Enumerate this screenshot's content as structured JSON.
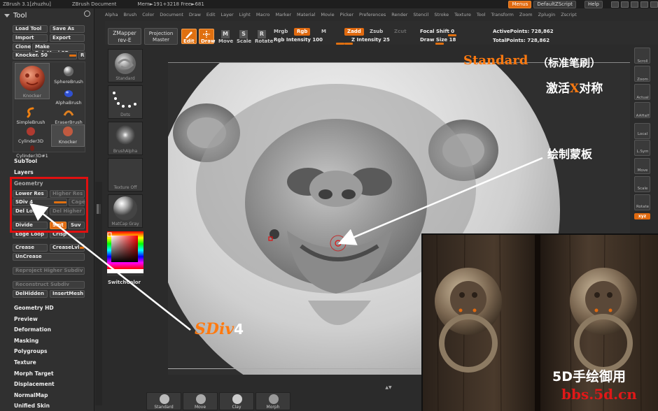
{
  "titlebar": {
    "app": "ZBrush 3.1[zhuzhu]",
    "doc": "ZBrush Document",
    "mem": "Mem►191+3218  Free►681",
    "buttons": [
      "Menus",
      "DefaultZScript",
      "Help"
    ]
  },
  "menubar": [
    "Alpha",
    "Brush",
    "Color",
    "Document",
    "Draw",
    "Edit",
    "Layer",
    "Light",
    "Macro",
    "Marker",
    "Material",
    "Movie",
    "Picker",
    "Preferences",
    "Render",
    "Stencil",
    "Stroke",
    "Texture",
    "Tool",
    "Transform",
    "Zoom",
    "Zplugin",
    "Zscript"
  ],
  "tool_panel": {
    "title": "Tool",
    "buttons": {
      "load_tool": "Load Tool",
      "save_as": "Save As",
      "import": "Import",
      "export": "Export",
      "clone": "Clone",
      "make_polymesh": "Make PolyMesh3D",
      "knocker_slider": "Knocker. 50",
      "r": "R"
    },
    "brushes": [
      {
        "label": "Knocker"
      },
      {
        "label": "SphereBrush"
      },
      {
        "label": "AlphaBrush"
      },
      {
        "label": "SimpleBrush"
      },
      {
        "label": "EraserBrush"
      },
      {
        "label": "Cylinder3D"
      },
      {
        "label": "Knocker"
      },
      {
        "label": "Cylinder3D#1"
      }
    ],
    "sections": {
      "subtool": "SubTool",
      "layers": "Layers",
      "geometry": "Geometry"
    },
    "geometry": {
      "lower_res": "Lower Res",
      "higher_res": "Higher Res",
      "sdiv": "SDiv 4",
      "cage": "Cage",
      "del_lower": "Del Lower",
      "del_higher": "Del Higher",
      "divide": "Divide",
      "smt": "Smt",
      "suv": "Suv",
      "edge_loop": "Edge Loop",
      "crisp": "Crisp",
      "crease": "Crease",
      "creaselvl": "CreaseLvl",
      "uncrease": "UnCrease",
      "reproject": "Reproject Higher Subdiv",
      "reconstruct": "Reconstruct Subdiv",
      "delhidden": "DelHidden",
      "insertmesh": "InsertMesh"
    },
    "more_sections": [
      "Geometry HD",
      "Preview",
      "Deformation",
      "Masking",
      "Polygroups",
      "Texture",
      "Morph Target",
      "Displacement",
      "NormalMap",
      "Unified Skin"
    ]
  },
  "left_shelf": [
    {
      "label": "Standard"
    },
    {
      "label": "Dots"
    },
    {
      "label": "BrushAlpha"
    },
    {
      "label": "Texture Off"
    },
    {
      "label": "MatCap Gray"
    }
  ],
  "switchcolor": "SwitchColor",
  "top_shelf": {
    "zmapper": "ZMapper",
    "zmapper_sub": "rev-E",
    "projection": "Projection",
    "projection_sub": "Master",
    "edit": "Edit",
    "draw": "Draw",
    "move": "Move",
    "scale": "Scale",
    "rotate": "Rotate",
    "mrgb": "Mrgb",
    "rgb": "Rgb",
    "m": "M",
    "rgb_intensity": "Rgb Intensity 100",
    "zadd": "Zadd",
    "zsub": "Zsub",
    "zcut": "Zcut",
    "z_intensity": "Z Intensity 25",
    "focal_shift": "Focal Shift 0",
    "draw_size": "Draw Size 18",
    "active_points": "ActivePoints: 728,862",
    "total_points": "TotalPoints: 728,862"
  },
  "right_shelf": [
    "Scroll",
    "Zoom",
    "Actual",
    "AAHalf",
    "Local",
    "L.Sym",
    "Move",
    "Scale",
    "Rotate",
    "xyz"
  ],
  "bottom_tray": [
    "Standard",
    "Move",
    "Clay",
    "Morph"
  ],
  "annotations": {
    "standard_title": "Standard",
    "standard_cn": "（标准笔刷）",
    "activate_prefix": "激活",
    "activate_x": "X",
    "activate_suffix": "对称",
    "draw_mask": "绘制蒙板",
    "sdiv_label": "SDiv",
    "sdiv_num": "4",
    "watermark1": "5D手绘御用",
    "watermark2": "bbs.5d.cn"
  },
  "colors": {
    "accent": "#e06a10",
    "annotation_orange": "#ff7a10",
    "highlight_red": "#e01010",
    "watermark_red": "#e01818"
  }
}
